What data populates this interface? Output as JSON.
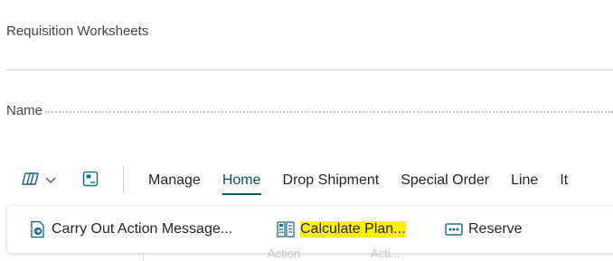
{
  "page": {
    "title": "Requisition Worksheets"
  },
  "field": {
    "name_label": "Name"
  },
  "toolbar": {
    "edit_icon": "edit-page-icon",
    "dropdown_icon": "chevron-down-icon",
    "page_icon": "open-page-icon",
    "tabs": [
      "Manage",
      "Home",
      "Drop Shipment",
      "Special Order",
      "Line",
      "It"
    ],
    "active_tab": "Home"
  },
  "ribbon": {
    "actions": [
      {
        "label": "Carry Out Action Message...",
        "icon": "carry-out-action-icon"
      },
      {
        "label": "Calculate Plan...",
        "icon": "calculate-plan-icon",
        "highlighted": true
      },
      {
        "label": "Reserve",
        "icon": "reserve-icon"
      }
    ]
  },
  "background_hints": [
    "Action",
    "Acti..."
  ],
  "colors": {
    "accent": "#00565e",
    "highlight": "#fff200",
    "icon_teal": "#1f6f8b"
  }
}
